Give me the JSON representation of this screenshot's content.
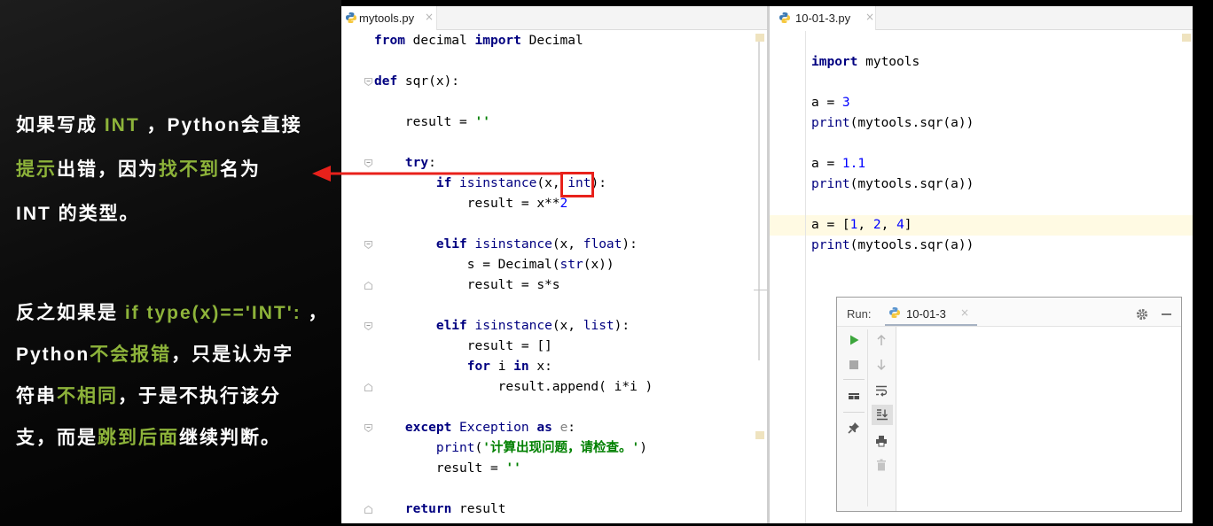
{
  "colors": {
    "annotation_text": "#ffffff",
    "annotation_highlight": "#8db33a",
    "callout_red": "#e8211b",
    "current_line": "#fffae3",
    "keyword": "#000080",
    "number": "#0000ff",
    "string": "#008000"
  },
  "annotations": {
    "block1": [
      [
        [
          "如果写成 ",
          "#ffffff"
        ],
        [
          "INT",
          "#8db33a"
        ],
        [
          " ，Python会直接",
          "#ffffff"
        ]
      ],
      [
        [
          "提示",
          "#8db33a"
        ],
        [
          "出错，因为",
          "#ffffff"
        ],
        [
          "找不到",
          "#8db33a"
        ],
        [
          "名为",
          "#ffffff"
        ]
      ],
      [
        [
          "INT 的类型。",
          "#ffffff"
        ]
      ]
    ],
    "block2": [
      [
        [
          "反之如果是 ",
          "#ffffff"
        ],
        [
          "if type(x)=='INT':",
          "#8db33a"
        ],
        [
          " ，",
          "#ffffff"
        ]
      ],
      [
        [
          "Python",
          "#ffffff"
        ],
        [
          "不会报错",
          "#8db33a"
        ],
        [
          "，只是认为字",
          "#ffffff"
        ]
      ],
      [
        [
          "符串",
          "#ffffff"
        ],
        [
          "不相同",
          "#8db33a"
        ],
        [
          "，于是不执行该分",
          "#ffffff"
        ]
      ],
      [
        [
          "支，而是",
          "#ffffff"
        ],
        [
          "跳到后面",
          "#8db33a"
        ],
        [
          "继续判断。",
          "#ffffff"
        ]
      ]
    ]
  },
  "editor_left": {
    "tab": {
      "label": "mytools.py",
      "close": "×",
      "icon": "python-file-icon"
    },
    "lines": [
      [
        [
          "from",
          "#000080",
          true
        ],
        [
          " decimal ",
          "#000000",
          false
        ],
        [
          "import",
          "#000080",
          true
        ],
        [
          " Decimal",
          "#000000",
          false
        ]
      ],
      [],
      [
        [
          "def",
          "#000080",
          true
        ],
        [
          " sqr(x):",
          "#000000",
          false
        ]
      ],
      [],
      [
        [
          "    result = ",
          "#000000",
          false
        ],
        [
          "''",
          "#008000",
          true
        ]
      ],
      [],
      [
        [
          "    ",
          "#000000",
          false
        ],
        [
          "try",
          "#000080",
          true
        ],
        [
          ":",
          "#000000",
          false
        ]
      ],
      [
        [
          "        ",
          "#000000",
          false
        ],
        [
          "if",
          "#000080",
          true
        ],
        [
          " ",
          "#000000",
          false
        ],
        [
          "isinstance",
          "#000080",
          false
        ],
        [
          "(x, ",
          "#000000",
          false
        ],
        [
          "int",
          "#000080",
          false
        ],
        [
          "):",
          "#000000",
          false
        ]
      ],
      [
        [
          "            result = x**",
          "#000000",
          false
        ],
        [
          "2",
          "#0000ff",
          false
        ]
      ],
      [],
      [
        [
          "        ",
          "#000000",
          false
        ],
        [
          "elif",
          "#000080",
          true
        ],
        [
          " ",
          "#000000",
          false
        ],
        [
          "isinstance",
          "#000080",
          false
        ],
        [
          "(x, ",
          "#000000",
          false
        ],
        [
          "float",
          "#000080",
          false
        ],
        [
          "):",
          "#000000",
          false
        ]
      ],
      [
        [
          "            s = Decimal(",
          "#000000",
          false
        ],
        [
          "str",
          "#000080",
          false
        ],
        [
          "(x))",
          "#000000",
          false
        ]
      ],
      [
        [
          "            result = s*s",
          "#000000",
          false
        ]
      ],
      [],
      [
        [
          "        ",
          "#000000",
          false
        ],
        [
          "elif",
          "#000080",
          true
        ],
        [
          " ",
          "#000000",
          false
        ],
        [
          "isinstance",
          "#000080",
          false
        ],
        [
          "(x, ",
          "#000000",
          false
        ],
        [
          "list",
          "#000080",
          false
        ],
        [
          "):",
          "#000000",
          false
        ]
      ],
      [
        [
          "            result = []",
          "#000000",
          false
        ]
      ],
      [
        [
          "            ",
          "#000000",
          false
        ],
        [
          "for",
          "#000080",
          true
        ],
        [
          " i ",
          "#000000",
          false
        ],
        [
          "in",
          "#000080",
          true
        ],
        [
          " x:",
          "#000000",
          false
        ]
      ],
      [
        [
          "                result.append( i*i )",
          "#000000",
          false
        ]
      ],
      [],
      [
        [
          "    ",
          "#000000",
          false
        ],
        [
          "except",
          "#000080",
          true
        ],
        [
          " ",
          "#000000",
          false
        ],
        [
          "Exception",
          "#000080",
          false
        ],
        [
          " ",
          "#000000",
          false
        ],
        [
          "as",
          "#000080",
          true
        ],
        [
          " ",
          "#000000",
          false
        ],
        [
          "e",
          "#808080",
          false
        ],
        [
          ":",
          "#000000",
          false
        ]
      ],
      [
        [
          "        ",
          "#000000",
          false
        ],
        [
          "print",
          "#000080",
          false
        ],
        [
          "(",
          "#000000",
          false
        ],
        [
          "'计算出现问题，请检查。'",
          "#008000",
          true
        ],
        [
          ")",
          "#000000",
          false
        ]
      ],
      [
        [
          "        result = ",
          "#000000",
          false
        ],
        [
          "''",
          "#008000",
          true
        ]
      ],
      [],
      [
        [
          "    ",
          "#000000",
          false
        ],
        [
          "return",
          "#000080",
          true
        ],
        [
          " result",
          "#000000",
          false
        ]
      ]
    ]
  },
  "editor_right": {
    "tab": {
      "label": "10-01-3.py",
      "close": "×",
      "icon": "python-file-icon"
    },
    "lines": [
      [],
      [
        [
          "import",
          "#000080",
          true
        ],
        [
          " mytools",
          "#000000",
          false
        ]
      ],
      [],
      [
        [
          "a = ",
          "#000000",
          false
        ],
        [
          "3",
          "#0000ff",
          false
        ]
      ],
      [
        [
          "print",
          "#000080",
          false
        ],
        [
          "(mytools.sqr(a))",
          "#000000",
          false
        ]
      ],
      [],
      [
        [
          "a = ",
          "#000000",
          false
        ],
        [
          "1.1",
          "#0000ff",
          false
        ]
      ],
      [
        [
          "print",
          "#000080",
          false
        ],
        [
          "(mytools.sqr(a))",
          "#000000",
          false
        ]
      ],
      [],
      [
        [
          "a = [",
          "#000000",
          false
        ],
        [
          "1",
          "#0000ff",
          false
        ],
        [
          ", ",
          "#000000",
          false
        ],
        [
          "2",
          "#0000ff",
          false
        ],
        [
          ", ",
          "#000000",
          false
        ],
        [
          "4",
          "#0000ff",
          false
        ],
        [
          "]",
          "#000000",
          false
        ]
      ],
      [
        [
          "print",
          "#000080",
          false
        ],
        [
          "(mytools.sqr(a))",
          "#000000",
          false
        ]
      ]
    ]
  },
  "run_panel": {
    "title": "Run:",
    "tab": {
      "label": "10-01-3",
      "close": "×",
      "icon": "python-file-icon"
    },
    "header_icons": [
      "gear-icon",
      "minimize-icon"
    ],
    "toolbar_icons": [
      "run-icon",
      "stop-icon",
      "layout-icon",
      "pin-icon",
      "up-arrow-icon",
      "down-arrow-icon",
      "soft-wrap-icon",
      "scroll-to-end-icon",
      "print-icon",
      "trash-icon"
    ]
  }
}
